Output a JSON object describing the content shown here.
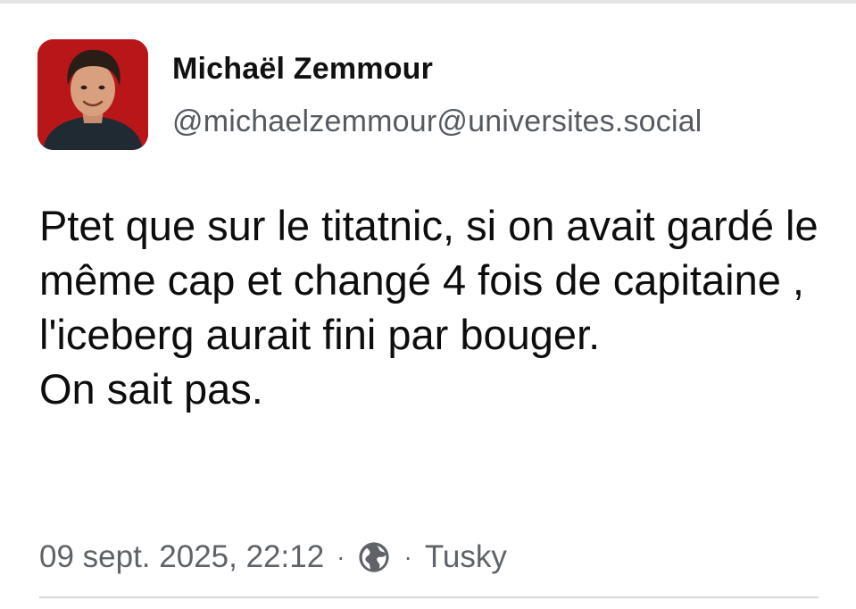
{
  "post": {
    "author": {
      "display_name": "Michaël Zemmour",
      "handle": "@michaelzemmour@universites.social"
    },
    "content_lines": [
      "Ptet que sur le titatnic, si on avait gardé le même cap et changé 4 fois de capitaine , l'iceberg aurait fini par bouger.",
      "On sait pas."
    ],
    "timestamp": "09 sept. 2025, 22:12",
    "separator": "·",
    "visibility_icon": "globe-icon",
    "client": "Tusky"
  },
  "colors": {
    "avatar_background": "#c8191c",
    "text_primary": "#111111",
    "text_secondary": "#5f6368"
  }
}
